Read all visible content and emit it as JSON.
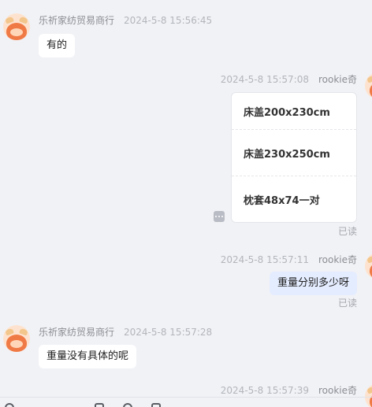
{
  "messages": [
    {
      "side": "left",
      "name": "乐祈家纺贸易商行",
      "time": "2024-5-8 15:56:45",
      "text": "有的"
    },
    {
      "side": "right",
      "name": "rookie奇",
      "time": "2024-5-8 15:57:08",
      "card_items": [
        "床盖200x230cm",
        "床盖230x250cm",
        "枕套48x74一对"
      ],
      "status": "已读"
    },
    {
      "side": "right",
      "name": "rookie奇",
      "time": "2024-5-8 15:57:11",
      "text": "重量分别多少呀",
      "status": "已读"
    },
    {
      "side": "left",
      "name": "乐祈家纺贸易商行",
      "time": "2024-5-8 15:57:28",
      "text": "重量没有具体的呢"
    },
    {
      "side": "right",
      "name": "rookie奇",
      "time": "2024-5-8 15:57:39"
    }
  ]
}
